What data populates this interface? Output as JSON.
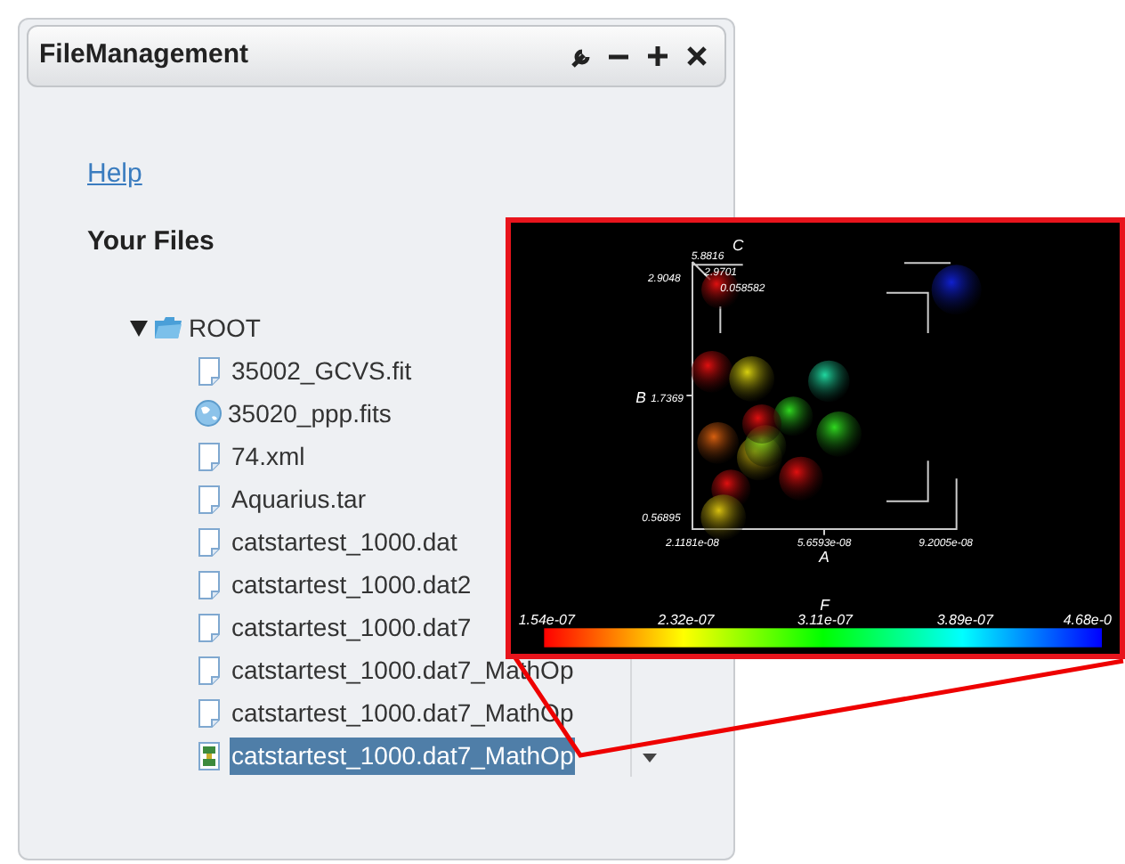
{
  "window": {
    "title": "FileManagement"
  },
  "help_link": "Help",
  "heading": "Your Files",
  "tree": {
    "label": "ROOT",
    "expanded": true,
    "children": [
      {
        "label": "35002_GCVS.fit",
        "kind": "document",
        "selected": false
      },
      {
        "label": "35020_ppp.fits",
        "kind": "globe",
        "selected": false
      },
      {
        "label": "74.xml",
        "kind": "document",
        "selected": false
      },
      {
        "label": "Aquarius.tar",
        "kind": "document",
        "selected": false
      },
      {
        "label": "catstartest_1000.dat",
        "kind": "document",
        "selected": false
      },
      {
        "label": "catstartest_1000.dat2",
        "kind": "document",
        "selected": false
      },
      {
        "label": "catstartest_1000.dat7",
        "kind": "document",
        "selected": false
      },
      {
        "label": "catstartest_1000.dat7_MathOp",
        "kind": "document",
        "selected": false
      },
      {
        "label": "catstartest_1000.dat7_MathOp",
        "kind": "document",
        "selected": false
      },
      {
        "label": "catstartest_1000.dat7_MathOp",
        "kind": "image",
        "selected": true
      }
    ]
  },
  "plot": {
    "axes": [
      {
        "name": "C",
        "ticks": [
          "5.8816",
          "2.9701",
          "0.058582"
        ]
      },
      {
        "name": "B",
        "ticks": [
          "2.9048",
          "1.7369",
          "0.56895"
        ]
      },
      {
        "name": "A",
        "ticks": [
          "2.1181e-08",
          "5.6593e-08",
          "9.2005e-08"
        ]
      }
    ],
    "colorbar": {
      "name": "F",
      "ticks": [
        "1.54e-07",
        "2.32e-07",
        "3.11e-07",
        "3.89e-07",
        "4.68e-0"
      ]
    }
  }
}
